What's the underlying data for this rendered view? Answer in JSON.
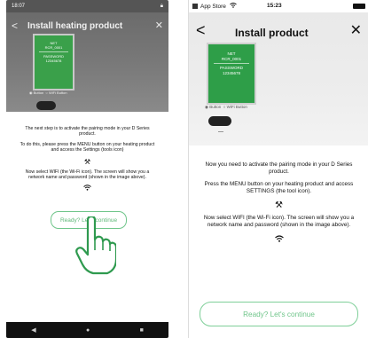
{
  "left": {
    "status_time": "18:07",
    "status_icon": "lock-icon",
    "title": "Install heating product",
    "display": {
      "net": "NET",
      "net_value": "RCR_0001",
      "pw": "PASSWORD",
      "pw_value": "12345678"
    },
    "radio_labels": [
      "Button",
      "WiFi Button"
    ],
    "text1": "The next step is to activate the pairing mode in your D Series product.",
    "text2": "To do this, please press the MENU button on your heating product and access the Settings (tools icon)",
    "text3": "Now select WIFI (the Wi-Fi icon). The screen will show you a network name and password (shown in the image above).",
    "cta": "Ready? Let's continue",
    "nav": [
      "◀",
      "●",
      "■"
    ]
  },
  "right": {
    "status_app": "App Store",
    "status_time": "15:23",
    "title": "Install product",
    "display": {
      "net": "NET",
      "net_value": "RCR_0001",
      "pw": "PASSWORD",
      "pw_value": "12345678"
    },
    "radio_labels": [
      "Button",
      "WiFi Button"
    ],
    "text1": "Now you need to activate the pairing mode in your D Series product.",
    "text2": "Press the MENU button on your heating product and access SETTINGS (the tool icon).",
    "text3": "Now select WIFI (the Wi-Fi icon). The screen will show you a network name and password (shown in the image above).",
    "cta": "Ready? Let's continue"
  }
}
